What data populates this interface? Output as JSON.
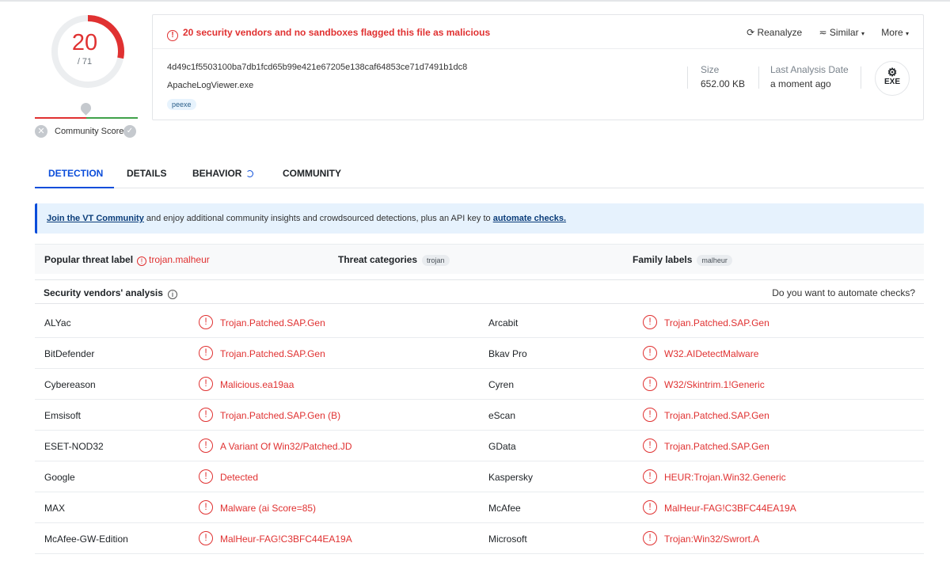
{
  "score": {
    "detected": "20",
    "total": "/ 71"
  },
  "community": {
    "label": "Community Score"
  },
  "header": {
    "warning": "20 security vendors and no sandboxes flagged this file as malicious",
    "actions": {
      "reanalyze": "Reanalyze",
      "similar": "Similar",
      "more": "More"
    },
    "hash": "4d49c1f5503100ba7db1fcd65b99e421e67205e138caf64853ce71d7491b1dc8",
    "filename": "ApacheLogViewer.exe",
    "tag": "peexe",
    "size_label": "Size",
    "size_value": "652.00 KB",
    "date_label": "Last Analysis Date",
    "date_value": "a moment ago",
    "file_type": "EXE"
  },
  "tabs": [
    "DETECTION",
    "DETAILS",
    "BEHAVIOR",
    "COMMUNITY"
  ],
  "banner": {
    "link1": "Join the VT Community",
    "text": " and enjoy additional community insights and crowdsourced detections, plus an API key to ",
    "link2": "automate checks."
  },
  "threat": {
    "popular_label": "Popular threat label",
    "popular_value": "trojan.malheur",
    "categories_label": "Threat categories",
    "categories_value": "trojan",
    "family_label": "Family labels",
    "family_value": "malheur"
  },
  "vendors": {
    "title": "Security vendors' analysis",
    "automate": "Do you want to automate checks?",
    "rows": [
      {
        "v1": "ALYac",
        "r1": "Trojan.Patched.SAP.Gen",
        "v2": "Arcabit",
        "r2": "Trojan.Patched.SAP.Gen"
      },
      {
        "v1": "BitDefender",
        "r1": "Trojan.Patched.SAP.Gen",
        "v2": "Bkav Pro",
        "r2": "W32.AIDetectMalware"
      },
      {
        "v1": "Cybereason",
        "r1": "Malicious.ea19aa",
        "v2": "Cyren",
        "r2": "W32/Skintrim.1!Generic"
      },
      {
        "v1": "Emsisoft",
        "r1": "Trojan.Patched.SAP.Gen (B)",
        "v2": "eScan",
        "r2": "Trojan.Patched.SAP.Gen"
      },
      {
        "v1": "ESET-NOD32",
        "r1": "A Variant Of Win32/Patched.JD",
        "v2": "GData",
        "r2": "Trojan.Patched.SAP.Gen"
      },
      {
        "v1": "Google",
        "r1": "Detected",
        "v2": "Kaspersky",
        "r2": "HEUR:Trojan.Win32.Generic"
      },
      {
        "v1": "MAX",
        "r1": "Malware (ai Score=85)",
        "v2": "McAfee",
        "r2": "MalHeur-FAG!C3BFC44EA19A"
      },
      {
        "v1": "McAfee-GW-Edition",
        "r1": "MalHeur-FAG!C3BFC44EA19A",
        "v2": "Microsoft",
        "r2": "Trojan:Win32/Swrort.A"
      }
    ]
  },
  "colors": {
    "malicious": "#e03131",
    "accent": "#0b4dda",
    "clean": "#40a14a"
  }
}
